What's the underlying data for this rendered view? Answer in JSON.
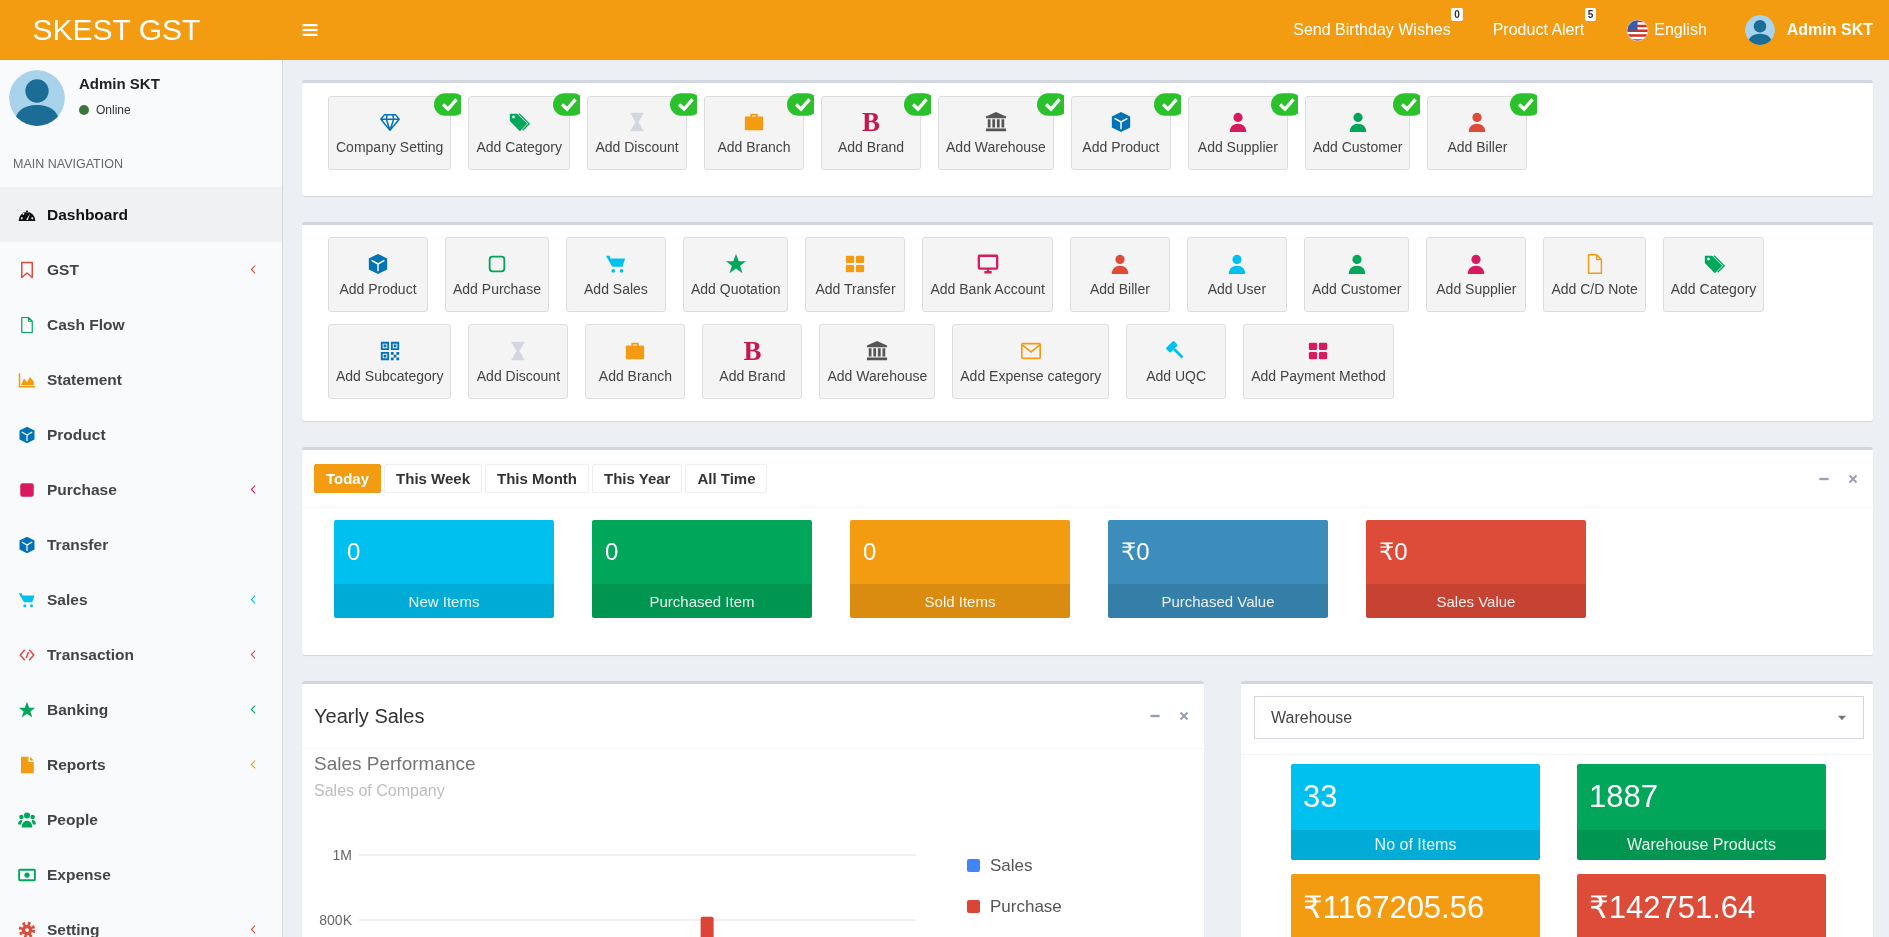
{
  "header": {
    "logo": "SKEST GST",
    "links": [
      {
        "label": "Send Birthday Wishes",
        "badge": "0"
      },
      {
        "label": "Product Alert",
        "badge": "5"
      }
    ],
    "language": "English",
    "user": "Admin SKT"
  },
  "sidebar": {
    "user": {
      "name": "Admin SKT",
      "status": "Online"
    },
    "section": "MAIN NAVIGATION",
    "items": [
      {
        "label": "Dashboard",
        "selected": true,
        "submenu": false
      },
      {
        "label": "GST",
        "selected": false,
        "submenu": true
      },
      {
        "label": "Cash Flow",
        "selected": false,
        "submenu": false
      },
      {
        "label": "Statement",
        "selected": false,
        "submenu": false
      },
      {
        "label": "Product",
        "selected": false,
        "submenu": false
      },
      {
        "label": "Purchase",
        "selected": false,
        "submenu": true
      },
      {
        "label": "Transfer",
        "selected": false,
        "submenu": false
      },
      {
        "label": "Sales",
        "selected": false,
        "submenu": true
      },
      {
        "label": "Transaction",
        "selected": false,
        "submenu": true
      },
      {
        "label": "Banking",
        "selected": false,
        "submenu": true
      },
      {
        "label": "Reports",
        "selected": false,
        "submenu": true
      },
      {
        "label": "People",
        "selected": false,
        "submenu": false
      },
      {
        "label": "Expense",
        "selected": false,
        "submenu": false
      },
      {
        "label": "Setting",
        "selected": false,
        "submenu": true
      }
    ]
  },
  "setup_steps": [
    {
      "label": "Company Setting",
      "checked": true
    },
    {
      "label": "Add Category",
      "checked": true
    },
    {
      "label": "Add Discount",
      "checked": true
    },
    {
      "label": "Add Branch",
      "checked": true
    },
    {
      "label": "Add Brand",
      "glyph": "B",
      "checked": true
    },
    {
      "label": "Add Warehouse",
      "checked": true
    },
    {
      "label": "Add Product",
      "checked": true
    },
    {
      "label": "Add Supplier",
      "checked": true
    },
    {
      "label": "Add Customer",
      "checked": true
    },
    {
      "label": "Add Biller",
      "checked": true
    }
  ],
  "quick_add": [
    {
      "label": "Add Product"
    },
    {
      "label": "Add Purchase"
    },
    {
      "label": "Add Sales"
    },
    {
      "label": "Add Quotation"
    },
    {
      "label": "Add Transfer"
    },
    {
      "label": "Add Bank Account"
    },
    {
      "label": "Add Biller"
    },
    {
      "label": "Add User"
    },
    {
      "label": "Add Customer"
    },
    {
      "label": "Add Supplier"
    },
    {
      "label": "Add C/D Note"
    },
    {
      "label": "Add Category"
    },
    {
      "label": "Add Subcategory"
    },
    {
      "label": "Add Discount"
    },
    {
      "label": "Add Branch"
    },
    {
      "label": "Add Brand",
      "glyph": "B"
    },
    {
      "label": "Add Warehouse"
    },
    {
      "label": "Add Expense category"
    },
    {
      "label": "Add UQC"
    },
    {
      "label": "Add Payment Method"
    }
  ],
  "summary": {
    "tabs": [
      {
        "label": "Today",
        "selected": true
      },
      {
        "label": "This Week",
        "selected": false
      },
      {
        "label": "This Month",
        "selected": false
      },
      {
        "label": "This Year",
        "selected": false
      },
      {
        "label": "All Time",
        "selected": false
      }
    ],
    "stats": [
      {
        "value": "0",
        "label": "New Items",
        "color": "#00c0ef"
      },
      {
        "value": "0",
        "label": "Purchased Item",
        "color": "#00a65a"
      },
      {
        "value": "0",
        "label": "Sold Items",
        "color": "#f39c12"
      },
      {
        "value": "₹0",
        "label": "Purchased Value",
        "color": "#3c8dbc"
      },
      {
        "value": "₹0",
        "label": "Sales Value",
        "color": "#dd4b39"
      }
    ]
  },
  "yearly_sales": {
    "title": "Yearly Sales",
    "subtitle": "Sales of Company",
    "chart_data": {
      "type": "bar",
      "title": "Sales Performance",
      "ylim": [
        0,
        1000000
      ],
      "yticks": [
        {
          "value": 800000,
          "label": "800K"
        },
        {
          "value": 1000000,
          "label": "1M"
        }
      ],
      "series": [
        {
          "name": "Sales",
          "color": "#4285f4",
          "values": [
            null,
            null,
            null,
            null,
            null,
            null,
            null,
            null,
            null,
            null,
            null,
            null
          ]
        },
        {
          "name": "Purchase",
          "color": "#db4437",
          "values": [
            null,
            null,
            null,
            null,
            null,
            null,
            null,
            810000,
            null,
            null,
            null,
            null
          ]
        }
      ]
    }
  },
  "warehouse": {
    "select": "Warehouse",
    "stats": [
      {
        "value": "33",
        "label": "No of Items",
        "color": "#00c0ef"
      },
      {
        "value": "1887",
        "label": "Warehouse Products",
        "color": "#00a65a"
      },
      {
        "value": "₹1167205.56",
        "color": "#f39c12"
      },
      {
        "value": "₹142751.64",
        "color": "#dd4b39"
      }
    ]
  }
}
